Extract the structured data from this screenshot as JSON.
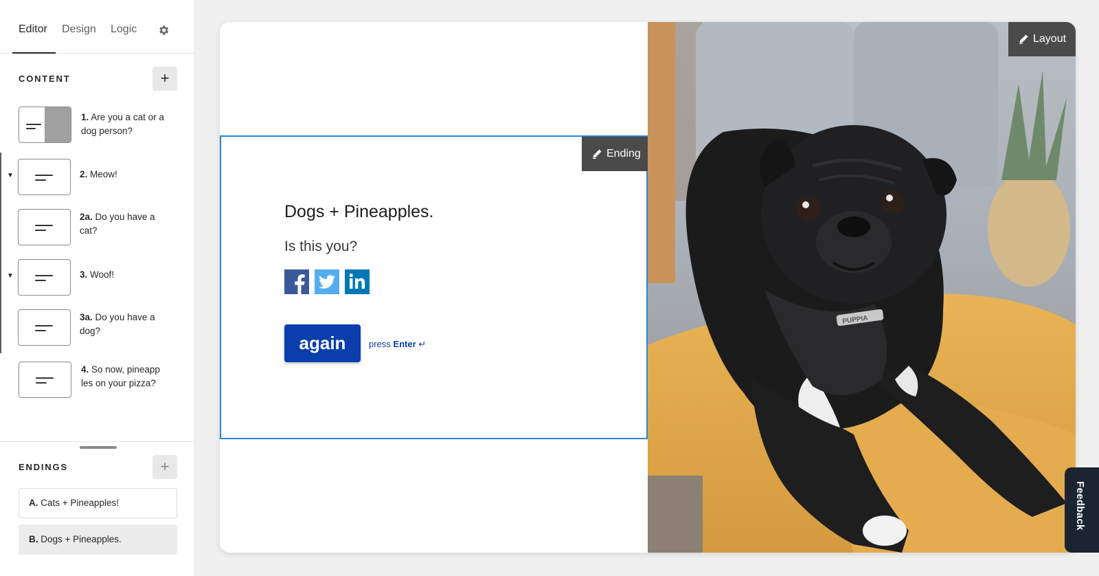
{
  "tabs": [
    {
      "label": "Editor"
    },
    {
      "label": "Design"
    },
    {
      "label": "Logic"
    }
  ],
  "content_section": {
    "title": "CONTENT",
    "add_label": "+",
    "items": [
      {
        "number": "1.",
        "text": "Are you a cat or a dog person?"
      },
      {
        "number": "2.",
        "text": "Meow!"
      },
      {
        "number": "2a.",
        "text": "Do you have a cat?"
      },
      {
        "number": "3.",
        "text": "Woof!"
      },
      {
        "number": "3a.",
        "text": "Do you have a dog?"
      },
      {
        "number": "4.",
        "text": "So now, pineapp les on your pizza?"
      }
    ]
  },
  "endings_section": {
    "title": "ENDINGS",
    "add_label": "+",
    "items": [
      {
        "letter": "A.",
        "text": "Cats + Pineapples!"
      },
      {
        "letter": "B.",
        "text": "Dogs + Pineapples."
      }
    ]
  },
  "ending_screen": {
    "tag_label": "Ending",
    "title": "Dogs + Pineapples.",
    "subtitle": "Is this you?",
    "button_label": "again",
    "press_prefix": "press",
    "press_key": "Enter",
    "press_symbol": "↵",
    "social": [
      "facebook-icon",
      "twitter-icon",
      "linkedin-icon"
    ]
  },
  "photo": {
    "layout_label": "Layout",
    "collar_text": "PUPPIA"
  },
  "feedback": {
    "label": "Feedback"
  },
  "colors": {
    "accent": "#0a3eac",
    "selection": "#2b86d6",
    "facebook": "#3b5998",
    "twitter": "#55acee",
    "linkedin": "#0077b5"
  }
}
